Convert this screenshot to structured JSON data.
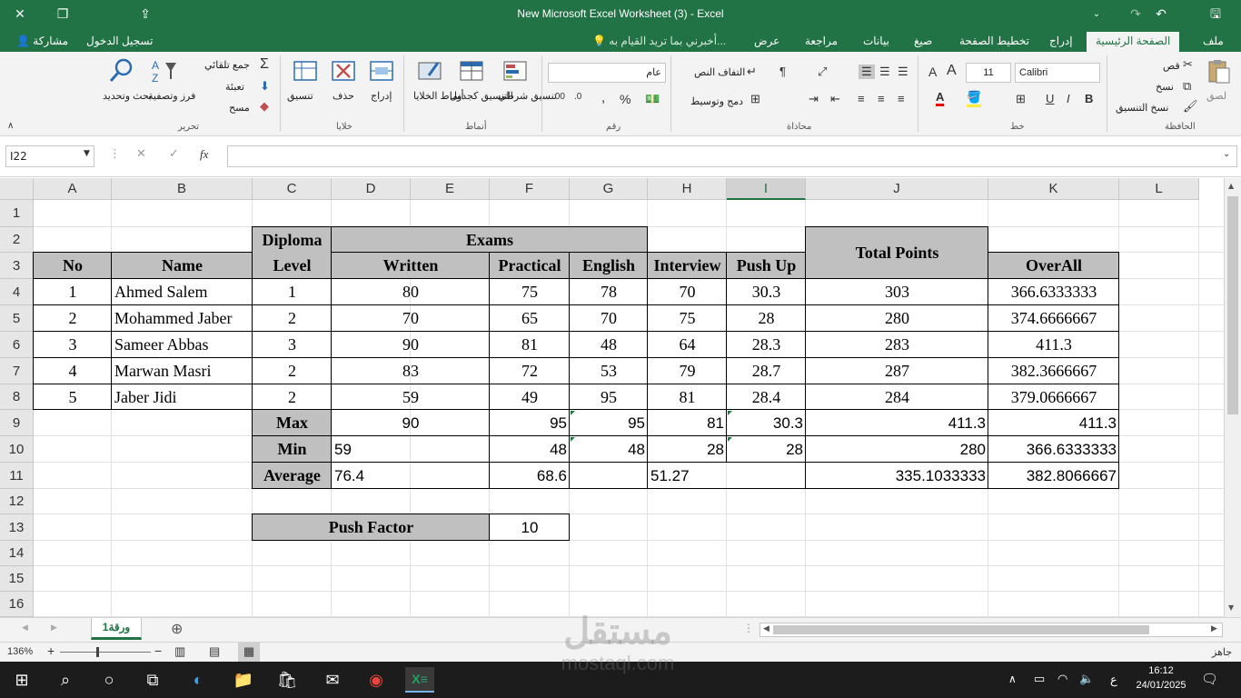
{
  "window": {
    "title": "New Microsoft Excel Worksheet (3) - Excel"
  },
  "tabs": {
    "file": "ملف",
    "home": "الصفحة الرئيسية",
    "insert": "إدراج",
    "page_layout": "تخطيط الصفحة",
    "formulas": "صيغ",
    "data": "بيانات",
    "review": "مراجعة",
    "view": "عرض",
    "tell_me": "أخبرني بما تريد القيام به...",
    "sign_in": "تسجيل الدخول",
    "share": "مشاركة"
  },
  "ribbon": {
    "clipboard": {
      "label": "الحافظة",
      "paste": "لصق",
      "cut": "قص",
      "copy": "نسخ",
      "format_painter": "نسخ التنسيق"
    },
    "font": {
      "label": "خط",
      "name": "Calibri",
      "size": "11"
    },
    "alignment": {
      "label": "محاذاة",
      "wrap": "التفاف النص",
      "merge": "دمج وتوسيط"
    },
    "number": {
      "label": "رقم",
      "format": "عام"
    },
    "styles": {
      "label": "أنماط",
      "conditional": "تنسيق شرطي",
      "table": "التنسيق كجدول",
      "cell": "أنماط الخلايا"
    },
    "cells": {
      "label": "خلايا",
      "insert": "إدراج",
      "delete": "حذف",
      "format": "تنسيق"
    },
    "editing": {
      "label": "تحرير",
      "autosum": "جمع تلقائي",
      "fill": "تعبئة",
      "clear": "مسح",
      "sort": "فرز وتصفية",
      "find": "بحث وتحديد"
    }
  },
  "formula_bar": {
    "name_box": "I22",
    "fx": "fx",
    "value": ""
  },
  "columns": [
    "A",
    "B",
    "C",
    "D",
    "E",
    "F",
    "G",
    "H",
    "I",
    "J",
    "K",
    "L"
  ],
  "rows": [
    "1",
    "2",
    "3",
    "4",
    "5",
    "6",
    "7",
    "8",
    "9",
    "10",
    "11",
    "12",
    "13",
    "14",
    "15",
    "16"
  ],
  "sheet": {
    "headers": {
      "no": "No",
      "name": "Name",
      "diploma": "Diploma",
      "level": "Level",
      "exams": "Exams",
      "written": "Written",
      "practical": "Practical",
      "english": "English",
      "interview": "Interview",
      "pushup": "Push Up",
      "total": "Total Points",
      "overall": "OverAll"
    },
    "students": [
      {
        "no": "1",
        "name": "Ahmed Salem",
        "level": "1",
        "written": "80",
        "practical": "75",
        "english": "78",
        "interview": "70",
        "pushup": "30.3",
        "total": "303",
        "overall": "366.6333333"
      },
      {
        "no": "2",
        "name": "Mohammed Jaber",
        "level": "2",
        "written": "70",
        "practical": "65",
        "english": "70",
        "interview": "75",
        "pushup": "28",
        "total": "280",
        "overall": "374.6666667"
      },
      {
        "no": "3",
        "name": "Sameer Abbas",
        "level": "3",
        "written": "90",
        "practical": "81",
        "english": "48",
        "interview": "64",
        "pushup": "28.3",
        "total": "283",
        "overall": "411.3"
      },
      {
        "no": "4",
        "name": "Marwan Masri",
        "level": "2",
        "written": "83",
        "practical": "72",
        "english": "53",
        "interview": "79",
        "pushup": "28.7",
        "total": "287",
        "overall": "382.3666667"
      },
      {
        "no": "5",
        "name": "Jaber Jidi",
        "level": "2",
        "written": "59",
        "practical": "49",
        "english": "95",
        "interview": "81",
        "pushup": "28.4",
        "total": "284",
        "overall": "379.0666667"
      }
    ],
    "stats": {
      "max": {
        "label": "Max",
        "written": "90",
        "practical": "95",
        "english": "95",
        "interview": "81",
        "pushup": "30.3",
        "total": "411.3",
        "overall": "411.3"
      },
      "min": {
        "label": "Min",
        "written": "59",
        "practical": "48",
        "english": "48",
        "interview": "28",
        "pushup": "28",
        "total": "280",
        "overall": "366.6333333"
      },
      "avg": {
        "label": "Average",
        "written": "76.4",
        "practical": "68.6",
        "interview": "51.27",
        "total": "335.1033333",
        "overall": "382.8066667"
      }
    },
    "push_factor": {
      "label": "Push Factor",
      "value": "10"
    }
  },
  "sheet_tabs": {
    "active": "ورقة1"
  },
  "status": {
    "ready": "جاهز",
    "zoom": "136%"
  },
  "taskbar": {
    "time": "16:12",
    "date": "24/01/2025",
    "lang": "ع"
  },
  "watermark": {
    "arabic": "مستقل",
    "latin": "mostaql.com"
  }
}
